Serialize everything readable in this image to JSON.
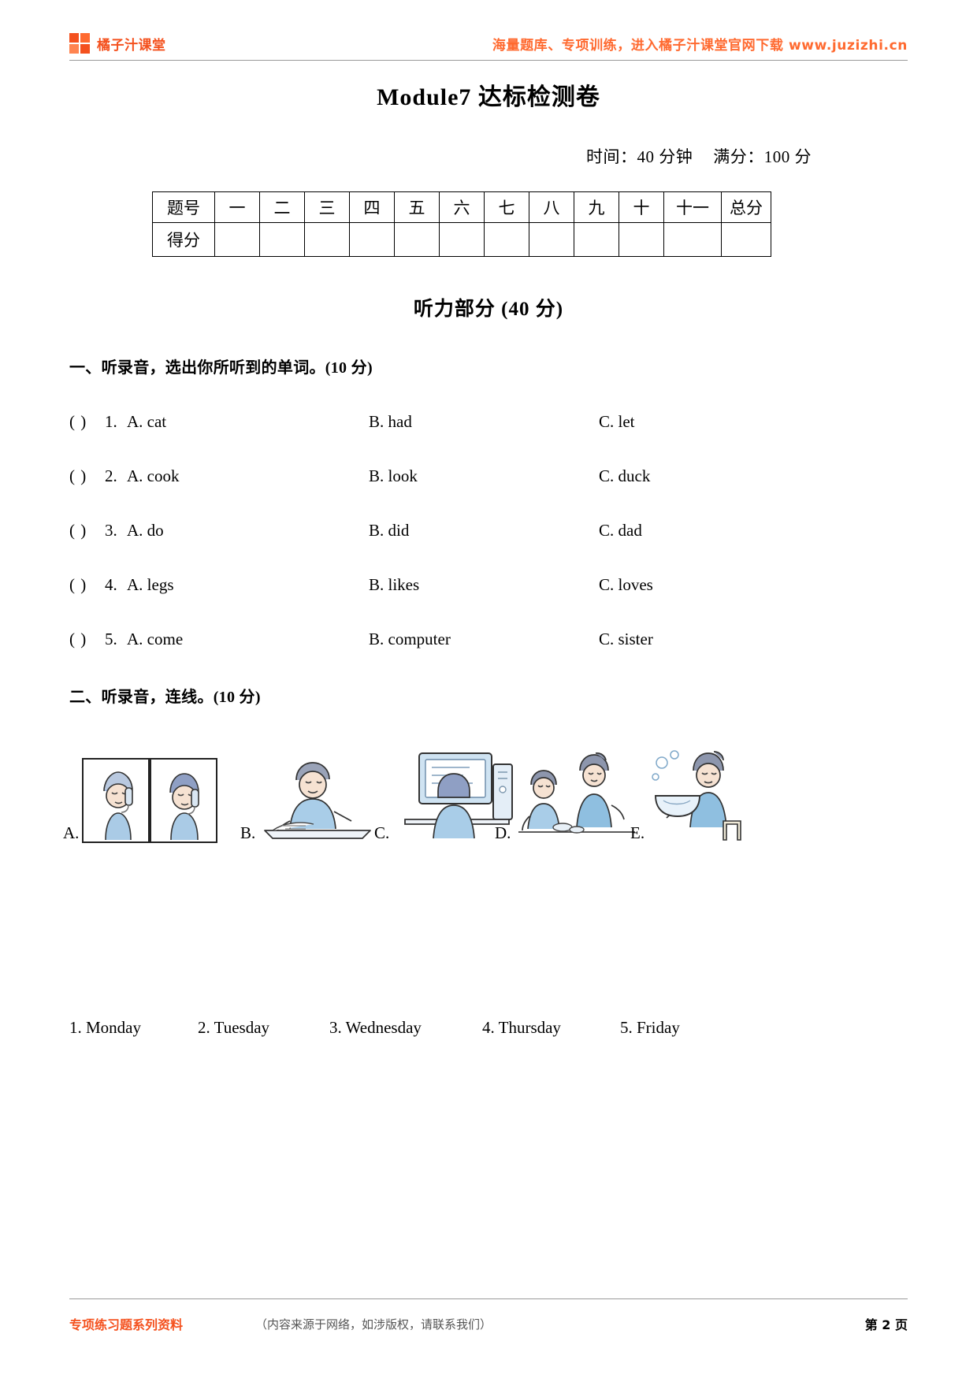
{
  "header": {
    "brand_name": "橘子汁课堂",
    "promo": "海量题库、专项训练，进入橘子汁课堂官网下载 www.juzizhi.cn"
  },
  "title": "Module7 达标检测卷",
  "meta": {
    "time_label": "时间：40 分钟",
    "score_label": "满分：100 分"
  },
  "score_table": {
    "row_label_1": "题号",
    "row_label_2": "得分",
    "columns": [
      "一",
      "二",
      "三",
      "四",
      "五",
      "六",
      "七",
      "八",
      "九",
      "十",
      "十一"
    ],
    "total_label": "总分"
  },
  "section": {
    "listening_heading": "听力部分 (40 分)"
  },
  "questions": {
    "q1_prompt": "一、听录音，选出你所听到的单词。(10 分)",
    "q2_prompt": "二、听录音，连线。(10 分)"
  },
  "mc_items": [
    {
      "paren": "(    )",
      "num": "1.",
      "a": "A. cat",
      "b": "B. had",
      "c": "C. let"
    },
    {
      "paren": "(    )",
      "num": "2.",
      "a": "A. cook",
      "b": "B. look",
      "c": "C. duck"
    },
    {
      "paren": "(    )",
      "num": "3.",
      "a": "A. do",
      "b": "B. did",
      "c": "C. dad"
    },
    {
      "paren": "(    )",
      "num": "4.",
      "a": "A. legs",
      "b": "B. likes",
      "c": "C. loves"
    },
    {
      "paren": "(    )",
      "num": "5.",
      "a": "A. come",
      "b": "B. computer",
      "c": "C. sister"
    }
  ],
  "pictures": [
    {
      "letter": "A.",
      "alt": "two-people-on-phone-icon"
    },
    {
      "letter": "B.",
      "alt": "boy-reading-at-desk-icon"
    },
    {
      "letter": "C.",
      "alt": "girl-at-computer-icon"
    },
    {
      "letter": "D.",
      "alt": "mother-and-child-cleaning-icon"
    },
    {
      "letter": "E.",
      "alt": "girl-washing-dishes-icon"
    }
  ],
  "days": [
    "1. Monday",
    "2. Tuesday",
    "3. Wednesday",
    "4. Thursday",
    "5. Friday"
  ],
  "footer": {
    "brand": "专项练习题系列资料",
    "note": "（内容来源于网络，如涉版权，请联系我们）",
    "page": "第 2 页"
  },
  "colors": {
    "brand_orange": "#F4511E",
    "promo_orange": "#FF6A30",
    "rule_gray": "#9a9a9a"
  }
}
